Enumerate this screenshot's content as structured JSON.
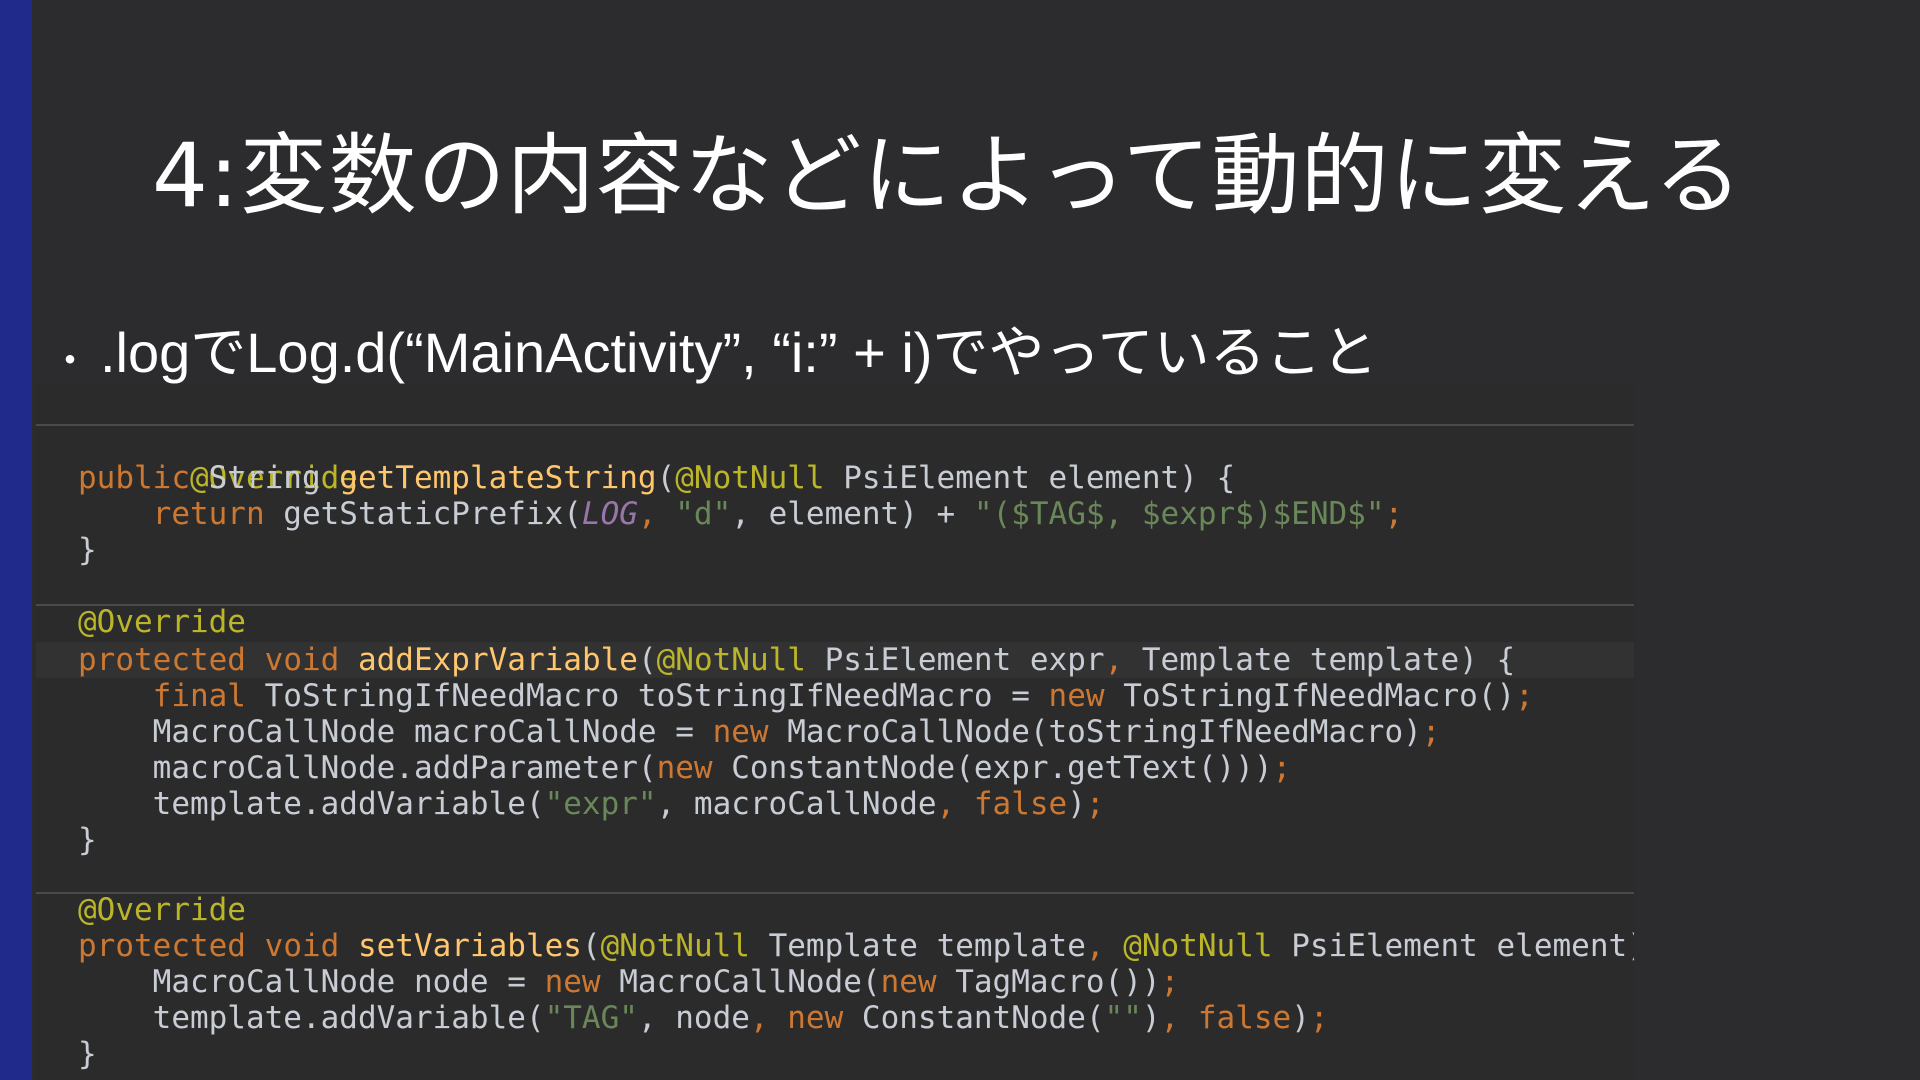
{
  "slide": {
    "title": "4:変数の内容などによって動的に変える",
    "bullet": ".logでLog.d(“MainActivity”, “i:” + i)でやっていること",
    "bullet_dot": "・"
  },
  "code": {
    "l1": [
      "@Override"
    ],
    "l2": [
      "public",
      " String ",
      "getTemplateString",
      "(",
      "@NotNull",
      " PsiElement element) {"
    ],
    "l3": [
      "    ",
      "return",
      " getStaticPrefix(",
      "LOG",
      ", ",
      "\"d\"",
      ", element) + ",
      "\"($TAG$, $expr$)$END$\"",
      ";"
    ],
    "l4": [
      "}"
    ],
    "l5": [
      "@Override"
    ],
    "l6": [
      "protected",
      " ",
      "void",
      " ",
      "addExprVariable",
      "(",
      "@NotNull",
      " PsiElement expr",
      ",",
      " Template template) {"
    ],
    "l7": [
      "    ",
      "final",
      " ToStringIfNeedMacro toStringIfNeedMacro = ",
      "new",
      " ToStringIfNeedMacro()",
      ";"
    ],
    "l8": [
      "    MacroCallNode macroCallNode = ",
      "new",
      " MacroCallNode(toStringIfNeedMacro)",
      ";"
    ],
    "l9": [
      "    macroCallNode.addParameter(",
      "new",
      " ConstantNode(expr.getText()))",
      ";"
    ],
    "l10": [
      "    template.addVariable(",
      "\"expr\"",
      ", macroCallNode",
      ",",
      " ",
      "false",
      ")",
      ";"
    ],
    "l11": [
      "}"
    ],
    "l12": [
      "@Override"
    ],
    "l13": [
      "protected",
      " ",
      "void",
      " ",
      "setVariables",
      "(",
      "@NotNull",
      " Template template",
      ",",
      " ",
      "@NotNull",
      " PsiElement element) {"
    ],
    "l14": [
      "    MacroCallNode node = ",
      "new",
      " MacroCallNode(",
      "new",
      " TagMacro())",
      ";"
    ],
    "l15": [
      "    template.addVariable(",
      "\"TAG\"",
      ", node",
      ",",
      " ",
      "new",
      " ConstantNode(",
      "\"\"",
      ")",
      ",",
      " ",
      "false",
      ")",
      ";"
    ],
    "l16": [
      "}"
    ]
  },
  "colors": {
    "background": "#2c2c2e",
    "accent_bar": "#1f2a8a",
    "code_background": "#2b2b2b",
    "annotation": "#bbb529",
    "keyword": "#cc7832",
    "method": "#ffc66d",
    "string": "#6a8759",
    "constant": "#9876aa",
    "identifier": "#c8ccd4"
  }
}
